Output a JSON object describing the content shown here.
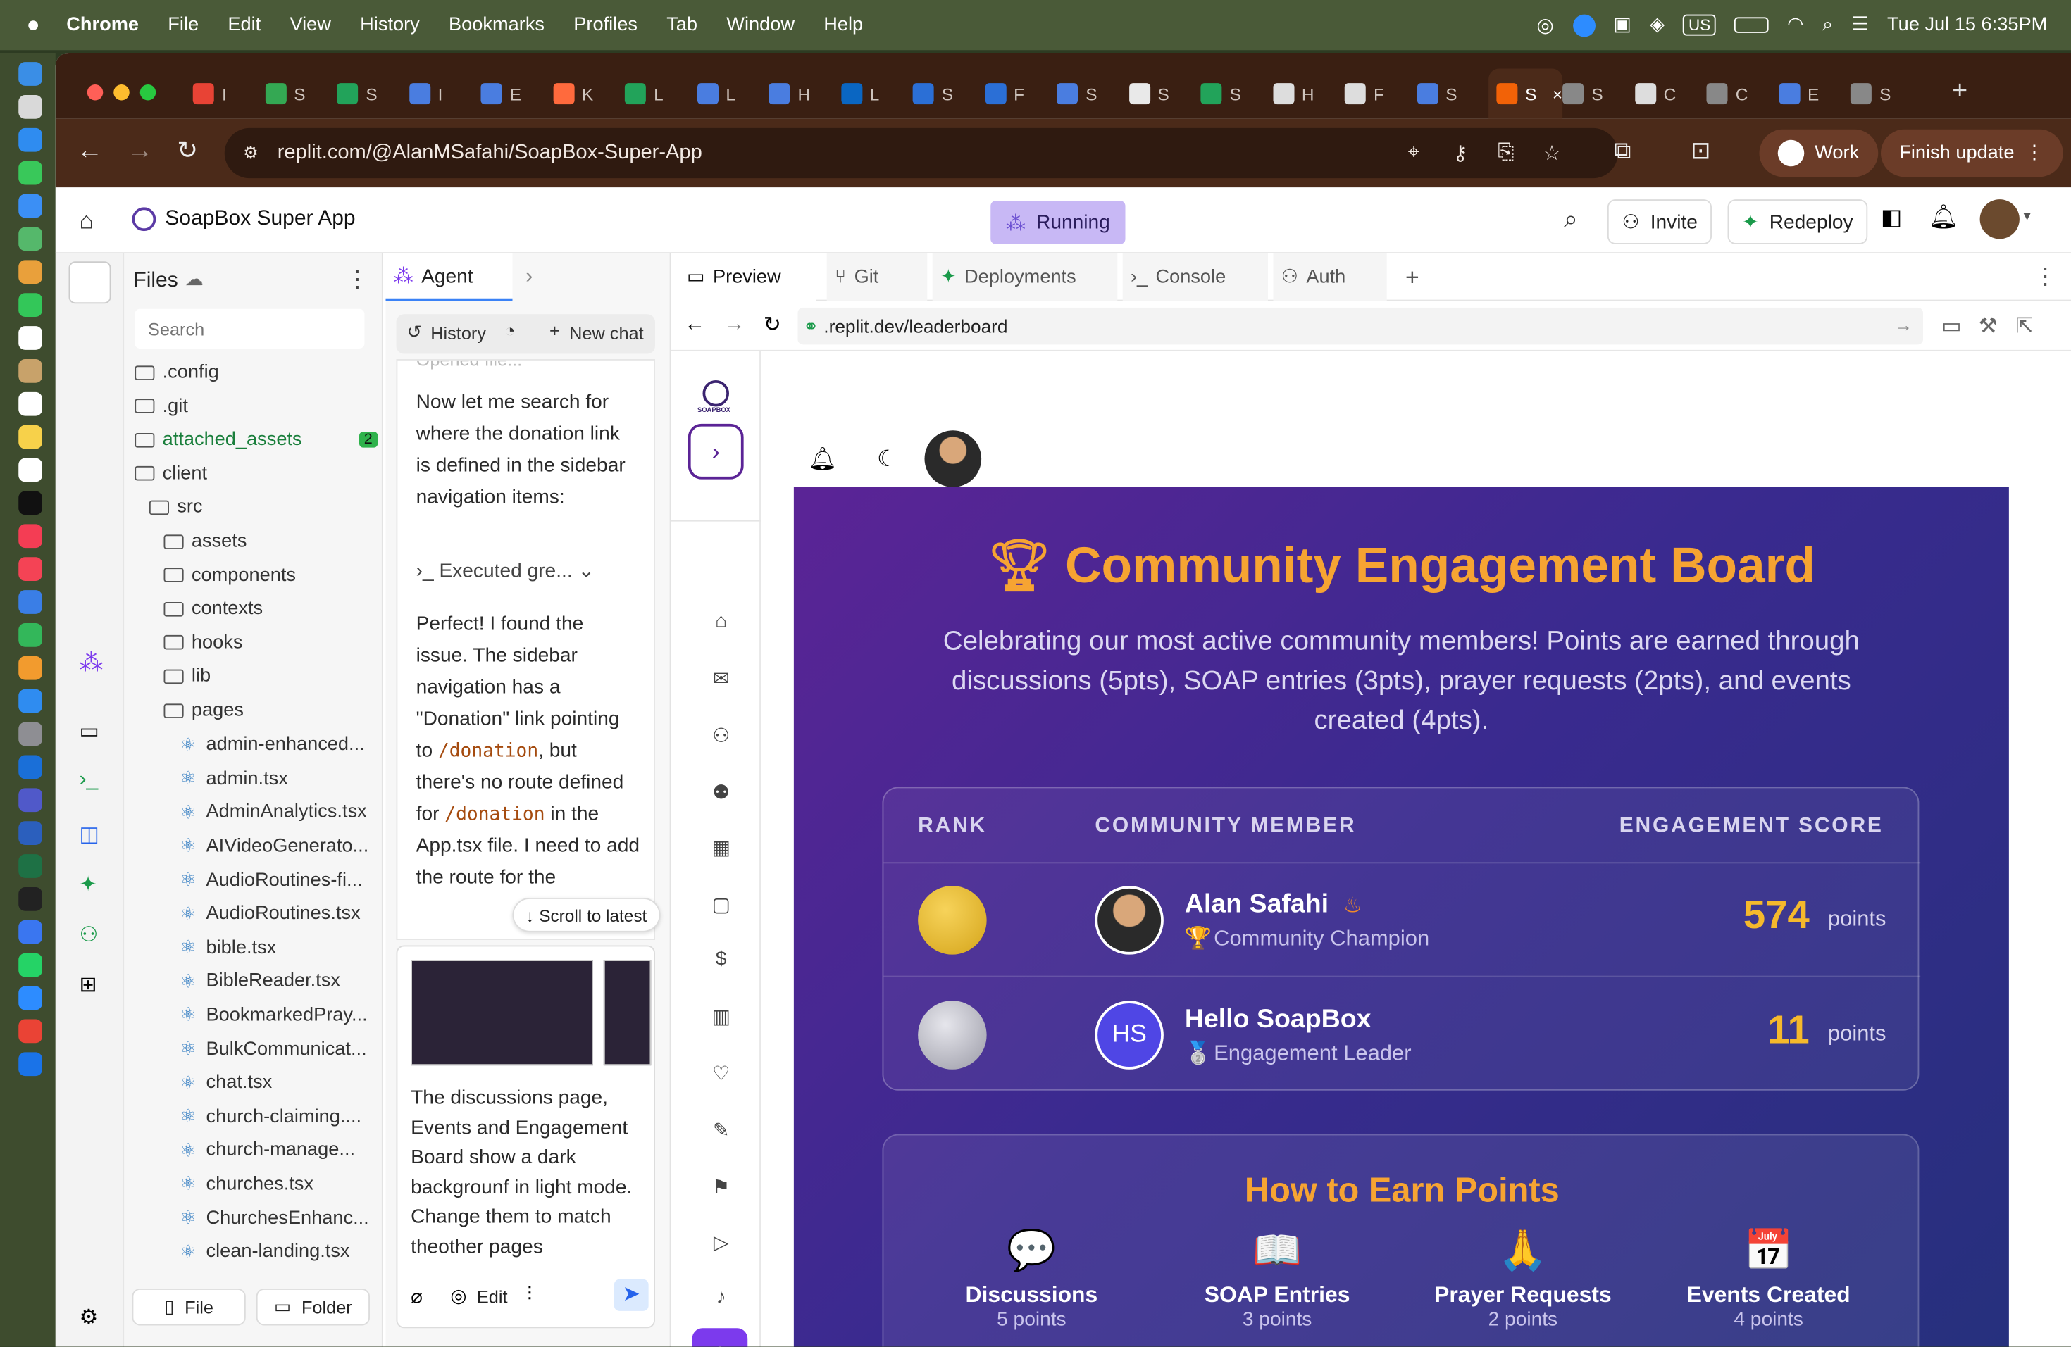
{
  "menubar": {
    "apple": "",
    "app": "Chrome",
    "items": [
      "File",
      "Edit",
      "View",
      "History",
      "Bookmarks",
      "Profiles",
      "Tab",
      "Window",
      "Help"
    ],
    "status_keyboard": "US",
    "clock": "Tue Jul 15  6:35PM"
  },
  "browser": {
    "tabs": [
      {
        "label": "I",
        "color": "#e84335"
      },
      {
        "label": "S",
        "color": "#34a853"
      },
      {
        "label": "S",
        "color": "#22a35a"
      },
      {
        "label": "I",
        "color": "#4a7de0"
      },
      {
        "label": "E",
        "color": "#4a7de0"
      },
      {
        "label": "K",
        "color": "#ff6a3d"
      },
      {
        "label": "L",
        "color": "#22a35a"
      },
      {
        "label": "L",
        "color": "#4a7de0"
      },
      {
        "label": "H",
        "color": "#4a7de0"
      },
      {
        "label": "L",
        "color": "#0a66c2"
      },
      {
        "label": "S",
        "color": "#2b6fd6"
      },
      {
        "label": "F",
        "color": "#2b6fd6"
      },
      {
        "label": "S",
        "color": "#4a7de0"
      },
      {
        "label": "S",
        "color": "#e9e9e9"
      },
      {
        "label": "S",
        "color": "#22a35a"
      },
      {
        "label": "H",
        "color": "#dddddd"
      },
      {
        "label": "F",
        "color": "#dddddd"
      },
      {
        "label": "S",
        "color": "#4a7de0"
      },
      {
        "label": "S",
        "color": "#f26207",
        "active": true
      },
      {
        "label": "S",
        "color": "#888888"
      },
      {
        "label": "C",
        "color": "#dddddd"
      },
      {
        "label": "C",
        "color": "#888888"
      },
      {
        "label": "E",
        "color": "#4a7de0"
      },
      {
        "label": "S",
        "color": "#888888"
      }
    ],
    "url": "replit.com/@AlanMSafahi/SoapBox-Super-App",
    "profile_label": "Work",
    "update_label": "Finish update"
  },
  "replit": {
    "project_name": "SoapBox Super App",
    "status": "Running",
    "invite_label": "Invite",
    "redeploy_label": "Redeploy",
    "files": {
      "title": "Files",
      "search_placeholder": "Search",
      "items": [
        {
          "name": ".config",
          "type": "folder",
          "depth": 0
        },
        {
          "name": ".git",
          "type": "folder",
          "depth": 0
        },
        {
          "name": "attached_assets",
          "type": "folder",
          "depth": 0,
          "badge": "2"
        },
        {
          "name": "client",
          "type": "folder",
          "depth": 0
        },
        {
          "name": "src",
          "type": "folder",
          "depth": 1
        },
        {
          "name": "assets",
          "type": "folder",
          "depth": 2
        },
        {
          "name": "components",
          "type": "folder",
          "depth": 2
        },
        {
          "name": "contexts",
          "type": "folder",
          "depth": 2
        },
        {
          "name": "hooks",
          "type": "folder",
          "depth": 2
        },
        {
          "name": "lib",
          "type": "folder",
          "depth": 2
        },
        {
          "name": "pages",
          "type": "folder",
          "depth": 2
        },
        {
          "name": "admin-enhanced...",
          "type": "file",
          "depth": 3
        },
        {
          "name": "admin.tsx",
          "type": "file",
          "depth": 3
        },
        {
          "name": "AdminAnalytics.tsx",
          "type": "file",
          "depth": 3
        },
        {
          "name": "AIVideoGenerato...",
          "type": "file",
          "depth": 3
        },
        {
          "name": "AudioRoutines-fi...",
          "type": "file",
          "depth": 3
        },
        {
          "name": "AudioRoutines.tsx",
          "type": "file",
          "depth": 3
        },
        {
          "name": "bible.tsx",
          "type": "file",
          "depth": 3
        },
        {
          "name": "BibleReader.tsx",
          "type": "file",
          "depth": 3
        },
        {
          "name": "BookmarkedPray...",
          "type": "file",
          "depth": 3
        },
        {
          "name": "BulkCommunicat...",
          "type": "file",
          "depth": 3
        },
        {
          "name": "chat.tsx",
          "type": "file",
          "depth": 3
        },
        {
          "name": "church-claiming....",
          "type": "file",
          "depth": 3
        },
        {
          "name": "church-manage...",
          "type": "file",
          "depth": 3
        },
        {
          "name": "churches.tsx",
          "type": "file",
          "depth": 3
        },
        {
          "name": "ChurchesEnhanc...",
          "type": "file",
          "depth": 3
        },
        {
          "name": "clean-landing.tsx",
          "type": "file",
          "depth": 3
        }
      ],
      "new_file_label": "File",
      "new_folder_label": "Folder"
    },
    "agent": {
      "tab_label": "Agent",
      "history_label": "History",
      "new_chat_label": "New chat",
      "faded_top": "Opened file...",
      "msg1": "Now let me search for where the donation link is defined in the sidebar navigation items:",
      "executed_label": "Executed gre...",
      "msg2_a": "Perfect! I found the issue. The sidebar navigation has a \"Donation\" link pointing to",
      "msg2_code1": "/donation",
      "msg2_b": ", but there's no route defined for",
      "msg2_code2": "/donation",
      "msg2_c": "in the App.tsx file. I need to add the route for the",
      "scroll_label": "Scroll to latest",
      "input_text": "The discussions page, Events and Engagement Board show a dark backgrounf in light mode. Change them to match theother pages",
      "edit_label": "Edit"
    },
    "preview_tabs": [
      "Preview",
      "Git",
      "Deployments",
      "Console",
      "Auth"
    ],
    "preview_url": ".replit.dev/leaderboard"
  },
  "app": {
    "logo_text": "SOAPBOX",
    "board": {
      "title": "Community Engagement Board",
      "subtitle": "Celebrating our most active community members! Points are earned through discussions (5pts), SOAP entries (3pts), prayer requests (2pts), and events created (4pts).",
      "col_rank": "RANK",
      "col_member": "COMMUNITY MEMBER",
      "col_score": "ENGAGEMENT SCORE",
      "rows": [
        {
          "name": "Alan Safahi",
          "role": "Community Champion",
          "role_emoji": "🏆",
          "points": "574",
          "unit": "points",
          "initials": "",
          "medal": "gold"
        },
        {
          "name": "Hello SoapBox",
          "role": "Engagement Leader",
          "role_emoji": "🥈",
          "points": "11",
          "unit": "points",
          "initials": "HS",
          "medal": "silver"
        }
      ],
      "earn_title": "How to Earn Points",
      "earn": [
        {
          "icon": "💬",
          "title": "Discussions",
          "sub": "5 points"
        },
        {
          "icon": "📖",
          "title": "SOAP Entries",
          "sub": "3 points"
        },
        {
          "icon": "🙏",
          "title": "Prayer Requests",
          "sub": "2 points"
        },
        {
          "icon": "📅",
          "title": "Events Created",
          "sub": "4 points"
        }
      ]
    }
  },
  "colors": {
    "accent": "#7c3aed",
    "gold": "#f5b92c",
    "title_orange": "#f6a432"
  }
}
